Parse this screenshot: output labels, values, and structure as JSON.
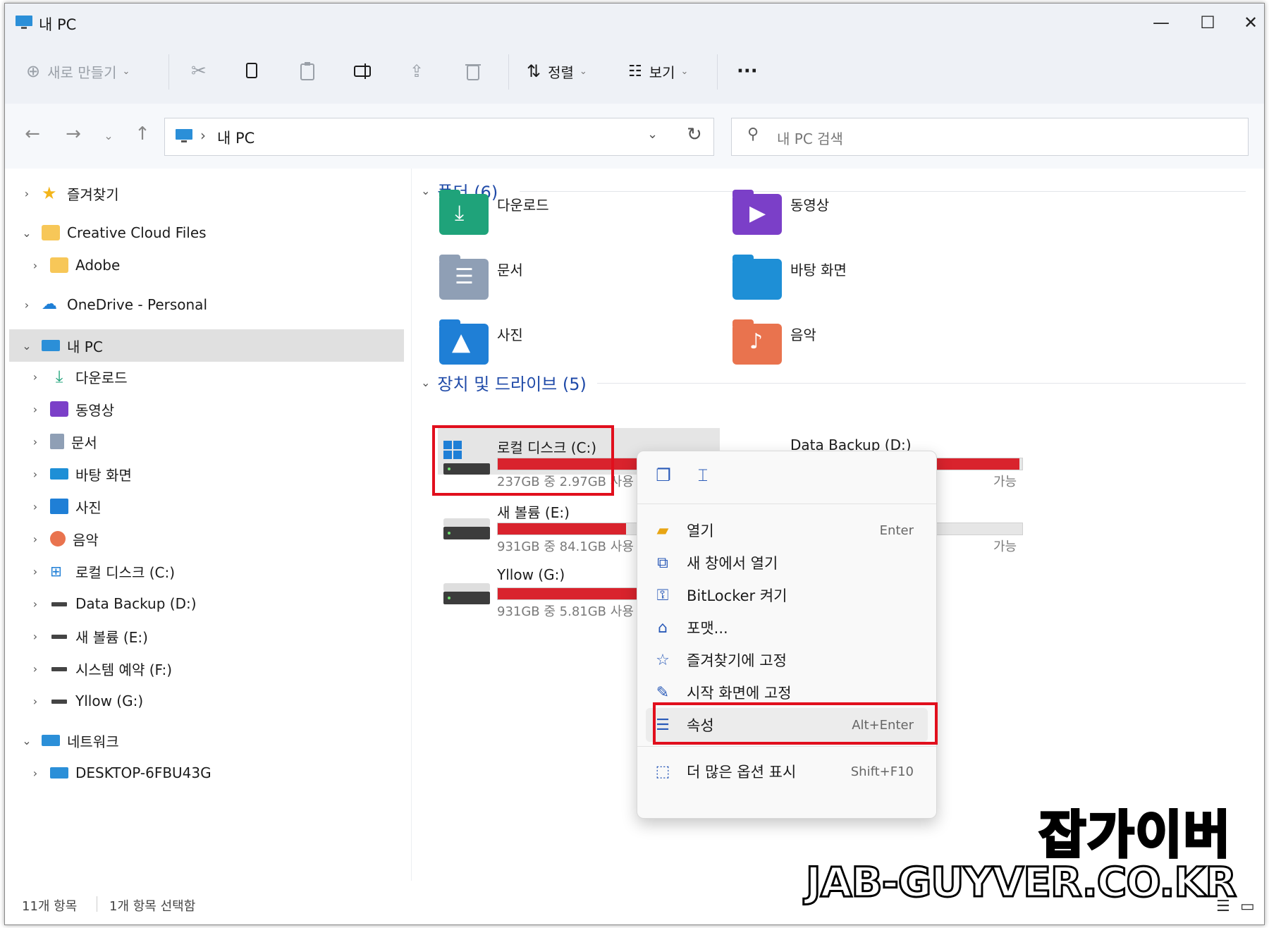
{
  "window": {
    "title": "내 PC",
    "minimize": "—",
    "maximize": "☐",
    "close": "✕"
  },
  "toolbar": {
    "new_label": "새로 만들기",
    "sort_label": "정렬",
    "view_label": "보기",
    "more_label": "···"
  },
  "address": {
    "path_sep": "›",
    "path": "내 PC",
    "search_placeholder": "내 PC 검색"
  },
  "sidebar": {
    "items": [
      {
        "label": "즐겨찾기",
        "chev": "›"
      },
      {
        "label": "Creative Cloud Files",
        "chev": "⌄"
      },
      {
        "label": "Adobe",
        "chev": "›"
      },
      {
        "label": "OneDrive - Personal",
        "chev": "›"
      },
      {
        "label": "내 PC",
        "chev": "⌄"
      },
      {
        "label": "다운로드",
        "chev": "›"
      },
      {
        "label": "동영상",
        "chev": "›"
      },
      {
        "label": "문서",
        "chev": "›"
      },
      {
        "label": "바탕 화면",
        "chev": "›"
      },
      {
        "label": "사진",
        "chev": "›"
      },
      {
        "label": "음악",
        "chev": "›"
      },
      {
        "label": "로컬 디스크 (C:)",
        "chev": "›"
      },
      {
        "label": "Data Backup (D:)",
        "chev": "›"
      },
      {
        "label": "새 볼륨 (E:)",
        "chev": "›"
      },
      {
        "label": "시스템 예약 (F:)",
        "chev": "›"
      },
      {
        "label": "Yllow (G:)",
        "chev": "›"
      },
      {
        "label": "네트워크",
        "chev": "⌄"
      },
      {
        "label": "DESKTOP-6FBU43G",
        "chev": "›"
      }
    ]
  },
  "content": {
    "folders_header": "폴더 (6)",
    "drives_header": "장치 및 드라이브 (5)",
    "folders": [
      {
        "label": "다운로드",
        "color": "#1fa37a"
      },
      {
        "label": "동영상",
        "color": "#7b3fc8"
      },
      {
        "label": "문서",
        "color": "#8f9fb5"
      },
      {
        "label": "바탕 화면",
        "color": "#1e8fd6"
      },
      {
        "label": "사진",
        "color": "#1f7fd6"
      },
      {
        "label": "음악",
        "color": "#e9734e"
      }
    ],
    "drives": [
      {
        "name": "로컬 디스크 (C:)",
        "info": "237GB 중 2.97GB 사용 가능",
        "used": 0.987
      },
      {
        "name": "Data Backup (D:)",
        "info": "가능",
        "used": 0.98
      },
      {
        "name": "새 볼륨 (E:)",
        "info": "931GB 중 84.1GB 사용 가능",
        "used": 0.91
      },
      {
        "name": "",
        "info": "가능",
        "used": 0.05
      },
      {
        "name": "Yllow (G:)",
        "info": "931GB 중 5.81GB 사용 가능",
        "used": 0.994
      }
    ]
  },
  "context_menu": {
    "items": [
      {
        "label": "열기",
        "key": "Enter",
        "icon": "folder-icon"
      },
      {
        "label": "새 창에서 열기",
        "key": "",
        "icon": "open-external-icon"
      },
      {
        "label": "BitLocker 켜기",
        "key": "",
        "icon": "key-icon"
      },
      {
        "label": "포맷...",
        "key": "",
        "icon": "format-icon"
      },
      {
        "label": "즐겨찾기에 고정",
        "key": "",
        "icon": "star-icon"
      },
      {
        "label": "시작 화면에 고정",
        "key": "",
        "icon": "pin-icon"
      },
      {
        "label": "속성",
        "key": "Alt+Enter",
        "icon": "properties-icon"
      },
      {
        "label": "더 많은 옵션 표시",
        "key": "Shift+F10",
        "icon": "more-options-icon"
      }
    ]
  },
  "status": {
    "count": "11개 항목",
    "selected": "1개 항목 선택함"
  },
  "watermark": {
    "korean": "잡가이버",
    "site": "JAB-GUYVER.CO.KR"
  },
  "colors": {
    "accent": "#1f4aa8",
    "drive_bar": "#d9232d",
    "highlight_box": "#e10f1d"
  }
}
